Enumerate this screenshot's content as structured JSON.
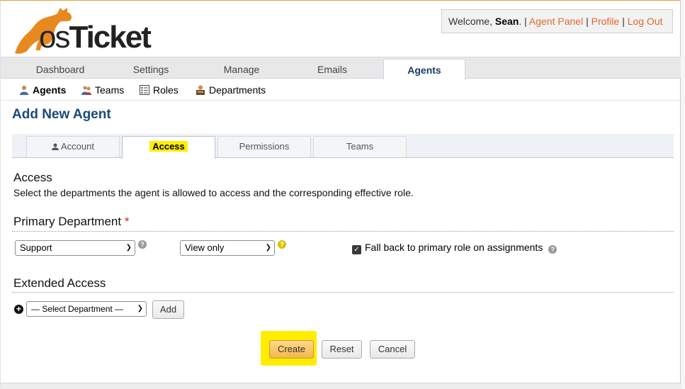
{
  "header": {
    "logo_text_os": "os",
    "logo_text_ticket": "Ticket",
    "welcome_prefix": "Welcome,",
    "user_name": "Sean",
    "separator": "|",
    "agent_panel": "Agent Panel",
    "profile": "Profile",
    "logout": "Log Out"
  },
  "nav": {
    "tabs": [
      "Dashboard",
      "Settings",
      "Manage",
      "Emails",
      "Agents"
    ],
    "active": "Agents"
  },
  "subnav": {
    "items": [
      "Agents",
      "Teams",
      "Roles",
      "Departments"
    ]
  },
  "page_title": "Add New Agent",
  "form_tabs": [
    "Account",
    "Access",
    "Permissions",
    "Teams"
  ],
  "access": {
    "heading": "Access",
    "description": "Select the departments the agent is allowed to access and the corresponding effective role.",
    "primary_heading": "Primary Department",
    "required_mark": "*",
    "department_value": "Support",
    "role_value": "View only",
    "fallback_label": "Fall back to primary role on assignments",
    "fallback_checked": true,
    "extended_heading": "Extended Access",
    "select_department_placeholder": "— Select Department —",
    "add_button": "Add"
  },
  "buttons": {
    "create": "Create",
    "reset": "Reset",
    "cancel": "Cancel"
  },
  "colors": {
    "brand_orange": "#e8891f",
    "link": "#e06a2c",
    "highlight": "#ffee00",
    "title_blue": "#1a4a7a"
  }
}
